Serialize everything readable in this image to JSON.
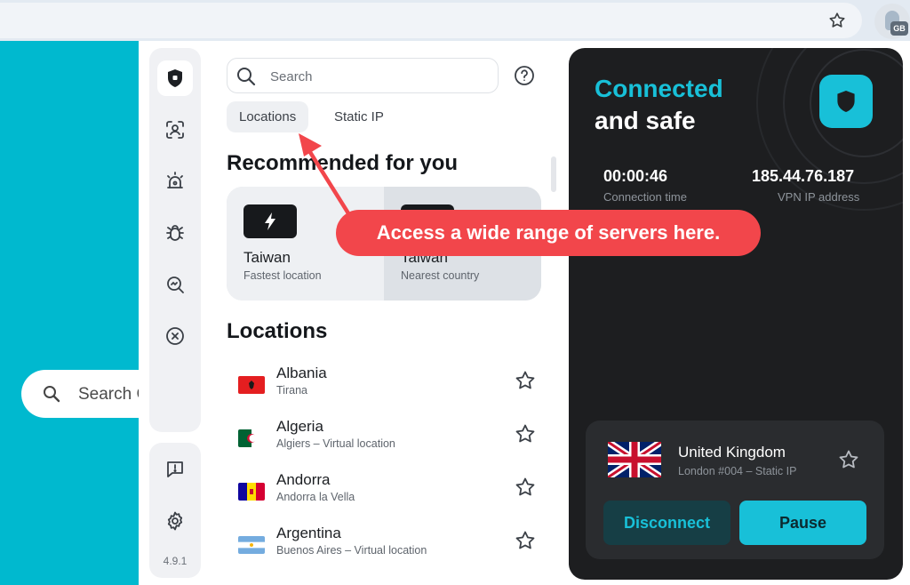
{
  "browser": {
    "extension_badge": "GB"
  },
  "background_page": {
    "search_placeholder": "Search G"
  },
  "sidebar": {
    "icons": [
      "shield-icon",
      "person-scan-icon",
      "alarm-icon",
      "bug-icon",
      "search-magnify-icon",
      "close-circle-icon"
    ],
    "bottom_icons": [
      "feedback-icon",
      "gear-icon"
    ],
    "version": "4.9.1"
  },
  "search": {
    "placeholder": "Search"
  },
  "tabs": [
    {
      "label": "Locations",
      "active": true
    },
    {
      "label": "Static IP",
      "active": false
    }
  ],
  "recommended": {
    "heading": "Recommended for you",
    "items": [
      {
        "name": "Taiwan",
        "sub": "Fastest location",
        "icon": "bolt-icon"
      },
      {
        "name": "Taiwan",
        "sub": "Nearest country",
        "icon": "flag-icon"
      }
    ]
  },
  "locations": {
    "heading": "Locations",
    "items": [
      {
        "name": "Albania",
        "sub": "Tirana"
      },
      {
        "name": "Algeria",
        "sub": "Algiers – Virtual location"
      },
      {
        "name": "Andorra",
        "sub": "Andorra la Vella"
      },
      {
        "name": "Argentina",
        "sub": "Buenos Aires – Virtual location"
      }
    ]
  },
  "status": {
    "line1": "Connected",
    "line2": "and safe",
    "connection_time": "00:00:46",
    "connection_time_label": "Connection time",
    "ip": "185.44.76.187",
    "ip_label": "VPN IP address"
  },
  "server": {
    "name": "United Kingdom",
    "sub": "London #004 – Static IP",
    "disconnect_label": "Disconnect",
    "pause_label": "Pause"
  },
  "annotation": {
    "text": "Access a wide range of servers here."
  },
  "colors": {
    "accent": "#18c0d8",
    "callout": "#f2464b",
    "panel": "#1d1e20",
    "page_bg": "#00b9cf"
  }
}
